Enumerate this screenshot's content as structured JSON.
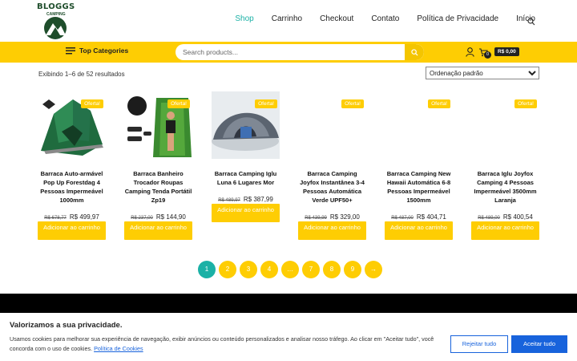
{
  "brand": {
    "name": "BLOGGS",
    "tagline": "CAMPING"
  },
  "nav": {
    "items": [
      "Shop",
      "Carrinho",
      "Checkout",
      "Contato",
      "Política de Privacidade",
      "Início"
    ],
    "active": "Shop"
  },
  "toolbar": {
    "top_categories_label": "Top Categories",
    "search_placeholder": "Search products...",
    "cart_count": "0",
    "cart_total": "R$ 0,00"
  },
  "shop": {
    "result_count": "Exibindo 1–6 de 52 resultados",
    "ordering_selected": "Ordenação padrão"
  },
  "products": [
    {
      "badge": "Oferta!",
      "title": "Barraca Auto-armável Pop Up Forestdag 4 Pessoas Impermeável 1000mm",
      "old_price": "R$ 678,77",
      "price": "R$ 499,97",
      "button": "Adicionar ao carrinho"
    },
    {
      "badge": "Oferta!",
      "title": "Barraca Banheiro Trocador Roupas Camping Tenda Portátil Zp19",
      "old_price": "R$ 237,00",
      "price": "R$ 144,90",
      "button": "Adicionar ao carrinho"
    },
    {
      "badge": "Oferta!",
      "title": "Barraca Camping Iglu Luna 6 Lugares Mor",
      "old_price": "R$ 489,97",
      "price": "R$ 387,99",
      "button": "Adicionar ao carrinho"
    },
    {
      "badge": "Oferta!",
      "title": "Barraca Camping Joyfox Instantânea 3-4 Pessoas Automática Verde UPF50+",
      "old_price": "R$ 439,99",
      "price": "R$ 329,00",
      "button": "Adicionar ao carrinho"
    },
    {
      "badge": "Oferta!",
      "title": "Barraca Camping New Hawaii Automática 6-8 Pessoas Impermeável 1500mm",
      "old_price": "R$ 487,00",
      "price": "R$ 404,71",
      "button": "Adicionar ao carrinho"
    },
    {
      "badge": "Oferta!",
      "title": "Barraca Iglu Joyfox Camping 4 Pessoas Impermeável 3500mm Laranja",
      "old_price": "R$ 489,00",
      "price": "R$ 400,54",
      "button": "Adicionar ao carrinho"
    }
  ],
  "pagination": {
    "pages": [
      "1",
      "2",
      "3",
      "4",
      "…",
      "7",
      "8",
      "9",
      "→"
    ],
    "current": "1"
  },
  "cookie": {
    "title": "Valorizamos a sua privacidade.",
    "text": "Usamos cookies para melhorar sua experiência de navegação, exibir anúncios ou conteúdo personalizados e analisar nosso tráfego. Ao clicar em \"Aceitar tudo\", você concorda com o uso de cookies.",
    "policy_link": "Política de Cookies",
    "reject_label": "Rejeitar tudo",
    "accept_label": "Aceitar tudo"
  },
  "colors": {
    "accent_yellow": "#fecd03",
    "active_teal": "#1bb1a6",
    "cookie_blue": "#1863dc",
    "logo_green": "#1e4d2b"
  },
  "icons": [
    "search-icon",
    "list-icon",
    "user-icon",
    "cart-icon"
  ]
}
